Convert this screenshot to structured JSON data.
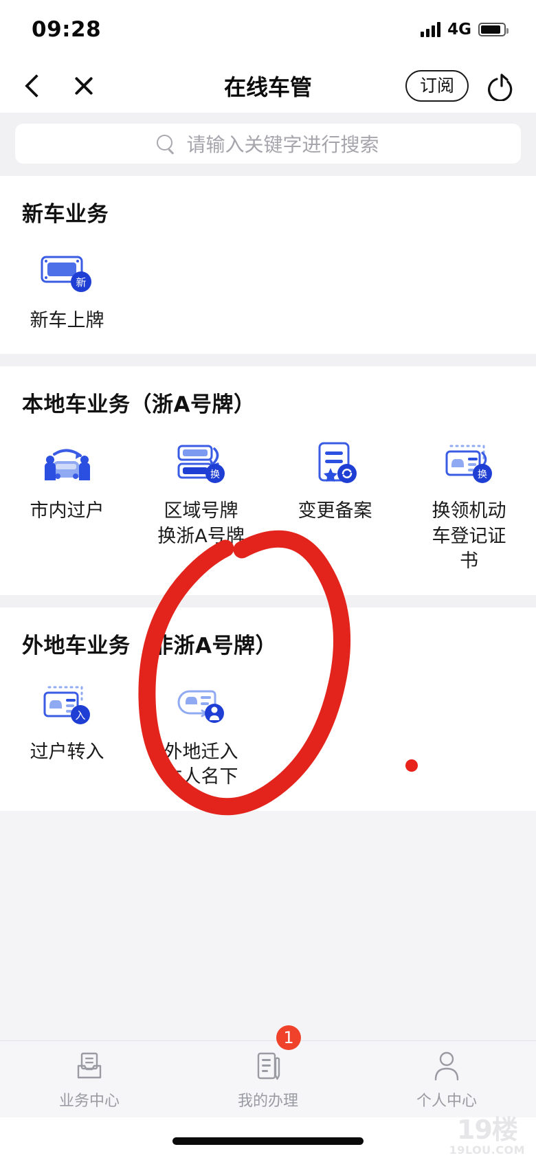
{
  "status_bar": {
    "time": "09:28",
    "network": "4G",
    "signal_icon": "signal-bars-icon",
    "battery_icon": "battery-icon"
  },
  "nav_bar": {
    "back_icon": "chevron-left-icon",
    "close_icon": "close-icon",
    "title": "在线车管",
    "subscribe_label": "订阅",
    "share_icon": "share-icon"
  },
  "search": {
    "icon": "search-icon",
    "placeholder": "请输入关键字进行搜索",
    "value": ""
  },
  "sections": [
    {
      "title": "新车业务",
      "items": [
        {
          "label": "新车上牌",
          "icon": "license-plate-new-icon"
        }
      ]
    },
    {
      "title": "本地车业务（浙A号牌）",
      "items": [
        {
          "label": "市内过户",
          "icon": "car-transfer-people-icon"
        },
        {
          "label": "区域号牌\n换浙A号牌",
          "icon": "plate-exchange-icon"
        },
        {
          "label": "变更备案",
          "icon": "document-change-icon"
        },
        {
          "label": "换领机动\n车登记证\n书",
          "icon": "vehicle-registration-exchange-icon"
        }
      ]
    },
    {
      "title": "外地车业务（非浙A号牌）",
      "items": [
        {
          "label": "过户转入",
          "icon": "vehicle-transfer-in-icon"
        },
        {
          "label": "外地迁入\n本人名下",
          "icon": "vehicle-move-in-person-icon"
        }
      ]
    }
  ],
  "annotation": {
    "shape": "red-ellipse-handdrawn",
    "color": "#e3241c",
    "dot_color": "#e8231b"
  },
  "tab_bar": {
    "tabs": [
      {
        "label": "业务中心",
        "icon": "inbox-document-icon",
        "badge": ""
      },
      {
        "label": "我的办理",
        "icon": "document-pen-icon",
        "badge": "1"
      },
      {
        "label": "个人中心",
        "icon": "person-icon",
        "badge": ""
      }
    ]
  },
  "watermark": {
    "line1": "19楼",
    "line2": "19LOU.COM"
  },
  "colors": {
    "brand_blue": "#2b4fe0",
    "light_blue": "#8fa9f2",
    "badge_red": "#f0412a",
    "annotation_red": "#e3241c",
    "page_bg": "#f1f1f3"
  }
}
